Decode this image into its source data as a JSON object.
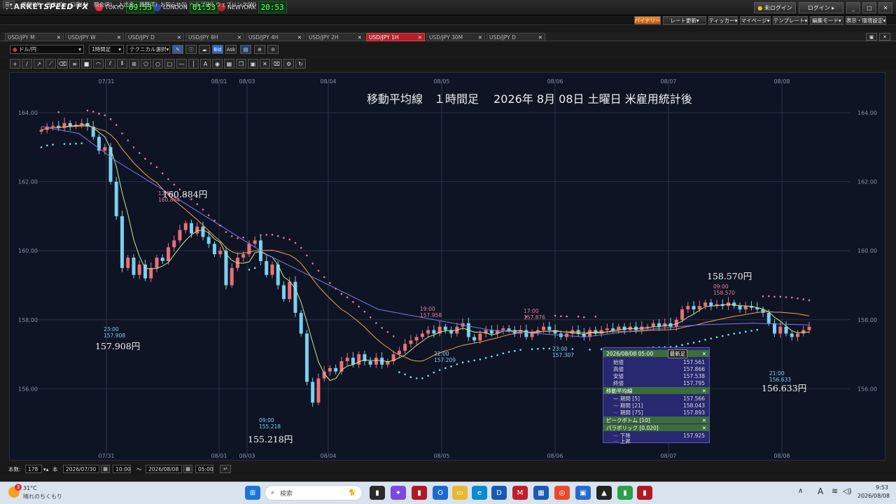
{
  "app": {
    "brand_a": "MARKET",
    "brand_b": "SPEED FX"
  },
  "clocks": [
    {
      "label": "TOKYO",
      "time": "09:53",
      "flag": "#e8303a"
    },
    {
      "label": "LONDON",
      "time": "01:53",
      "flag": "#2a4aa0"
    },
    {
      "label": "NEWYORK",
      "time": "20:53",
      "flag": "#b3202a"
    }
  ],
  "topright": {
    "notlogged": "未ログイン",
    "login": "ログイン"
  },
  "menu": [
    "情報(M)",
    "注文(O)",
    "口座(A)",
    "照会(R)",
    "入出金・振替(E)",
    "お知らせ(I)",
    "ヘルプ(H)",
    "ウェブリンク(W)"
  ],
  "rightbuttons": [
    "バイナリー",
    "レート更新",
    "ティッカー",
    "マイページ",
    "テンプレート",
    "編集モード",
    "表示・環境設定"
  ],
  "tabs": [
    "USD/JPY M",
    "USD/JPY W",
    "USD/JPY D",
    "USD/JPY 8H",
    "USD/JPY 4H",
    "USD/JPY 2H",
    "USD/JPY 1H",
    "USD/JPY 30M",
    "USD/JPY D"
  ],
  "toolbar": {
    "currency": "ドル/円",
    "period": "1時間足",
    "technical": "テクニカル選択",
    "bid": "Bid",
    "ask": "Ask"
  },
  "bottom": {
    "count_label": "本数:",
    "count": "178",
    "unit": "本",
    "from_date": "2026/07/30",
    "from_time": "10:00",
    "tilde": "〜",
    "to_date": "2026/08/08",
    "to_time": "05:00"
  },
  "overlay": {
    "date": "2026/08/08 05:00",
    "latest": "最新足",
    "rows": [
      {
        "k": "始値",
        "v": "157.561"
      },
      {
        "k": "高値",
        "v": "157.866"
      },
      {
        "k": "安値",
        "v": "157.538"
      },
      {
        "k": "終値",
        "v": "157.795"
      }
    ],
    "ma_title": "移動平均線",
    "ma": [
      {
        "k": "期間 [5]",
        "v": "157.566",
        "c": "#c8e890"
      },
      {
        "k": "期間 [21]",
        "v": "158.043",
        "c": "#f2a054"
      },
      {
        "k": "期間 [75]",
        "v": "157.893",
        "c": "#7a7ae8"
      }
    ],
    "peak": "ピークボトム [10]",
    "para": "パラボリック [0.020]",
    "para_rows": [
      {
        "k": "下降",
        "v": "157.925",
        "c": "#e87a9a"
      },
      {
        "k": "上昇",
        "v": "",
        "c": "#7a7ae8"
      }
    ]
  },
  "taskbar": {
    "weather_temp": "31°C",
    "weather_text": "晴れのちくもり",
    "search": "検索",
    "time": "9:53",
    "date": "2026/08/08",
    "lang": "A",
    "badge": "3"
  },
  "chart_data": {
    "type": "candlestick",
    "title": "移動平均線　１時間足　 2026年 8月 08日 土曜日 米雇用統計後",
    "ylim": [
      154.5,
      164.8
    ],
    "y_ticks": [
      "164.00",
      "162.00",
      "160.00",
      "158.00",
      "156.00"
    ],
    "x_ticks": [
      "07/31",
      "08/01",
      "08/03",
      "08/04",
      "08/05",
      "08/06",
      "08/07",
      "08/08"
    ],
    "callouts": [
      {
        "name": "high-callout",
        "big": "160.884円",
        "time": "12:00",
        "val": "160.884"
      },
      {
        "name": "low1-callout",
        "big": "157.908円",
        "time": "23:00",
        "val": "157.908"
      },
      {
        "name": "low2-callout",
        "big": "155.218円",
        "time": "09:00",
        "val": "155.218"
      },
      {
        "name": "high2-callout",
        "big": "",
        "time": "19:00",
        "val": "157.958"
      },
      {
        "name": "low3-callout",
        "big": "",
        "time": "22:00",
        "val": "157.209"
      },
      {
        "name": "high3-callout",
        "big": "",
        "time": "17:00",
        "val": "157.876"
      },
      {
        "name": "low4-callout",
        "big": "",
        "time": "23:00",
        "val": "157.307"
      },
      {
        "name": "high4-callout",
        "big": "158.570円",
        "time": "09:00",
        "val": "158.570"
      },
      {
        "name": "low5-callout",
        "big": "156.633円",
        "time": "21:00",
        "val": "156.633"
      }
    ],
    "colors": {
      "up": "#e8707a",
      "down": "#7ad0ee",
      "ma5": "#c8e890",
      "ma21": "#f2a054",
      "ma75": "#7a7ae8",
      "sar_down": "#e87a9a",
      "sar_up": "#7ae0f0",
      "callout_hi": "#e87a9a",
      "callout_lo": "#7ad0ee"
    },
    "closes": [
      163.5,
      163.6,
      163.62,
      163.55,
      163.7,
      163.6,
      163.65,
      163.7,
      163.6,
      163.3,
      162.9,
      163.0,
      162.0,
      161.0,
      159.5,
      159.8,
      159.3,
      159.6,
      159.2,
      159.5,
      159.8,
      159.7,
      160.1,
      160.3,
      160.6,
      160.8,
      160.5,
      160.7,
      160.4,
      160.2,
      159.9,
      160.0,
      159.0,
      159.5,
      159.8,
      159.9,
      160.2,
      160.3,
      159.7,
      159.3,
      159.6,
      159.0,
      158.6,
      159.1,
      158.2,
      157.6,
      156.2,
      155.6,
      156.3,
      156.5,
      156.6,
      156.5,
      156.8,
      156.9,
      156.7,
      157.0,
      156.8,
      156.7,
      156.9,
      156.7,
      156.8,
      157.0,
      157.1,
      157.3,
      157.4,
      157.5,
      157.6,
      157.7,
      157.6,
      157.8,
      157.7,
      157.6,
      157.8,
      157.9,
      157.5,
      157.4,
      157.6,
      157.7,
      157.6,
      157.7,
      157.75,
      157.7,
      157.6,
      157.7,
      157.5,
      157.65,
      157.7,
      157.8,
      157.7,
      157.6,
      157.5,
      157.6,
      157.7,
      157.6,
      157.5,
      157.7,
      157.6,
      157.7,
      157.75,
      157.7,
      157.8,
      157.7,
      157.8,
      157.7,
      157.8,
      157.8,
      157.9,
      157.8,
      157.9,
      157.8,
      158.0,
      158.3,
      158.4,
      158.3,
      158.4,
      158.5,
      158.4,
      158.45,
      158.4,
      158.5,
      158.4,
      158.3,
      158.4,
      158.35,
      158.3,
      158.2,
      157.9,
      157.6,
      157.8,
      157.6,
      157.5,
      157.6,
      157.7,
      157.8
    ],
    "ma75_path": [
      [
        0,
        163.6
      ],
      [
        10,
        163.4
      ],
      [
        20,
        162.6
      ],
      [
        35,
        161.6
      ],
      [
        60,
        159.9
      ],
      [
        90,
        158.3
      ],
      [
        120,
        157.7
      ],
      [
        145,
        157.5
      ],
      [
        160,
        157.7
      ],
      [
        175,
        157.85
      ],
      [
        190,
        157.9
      ],
      [
        205,
        157.85
      ]
    ]
  }
}
